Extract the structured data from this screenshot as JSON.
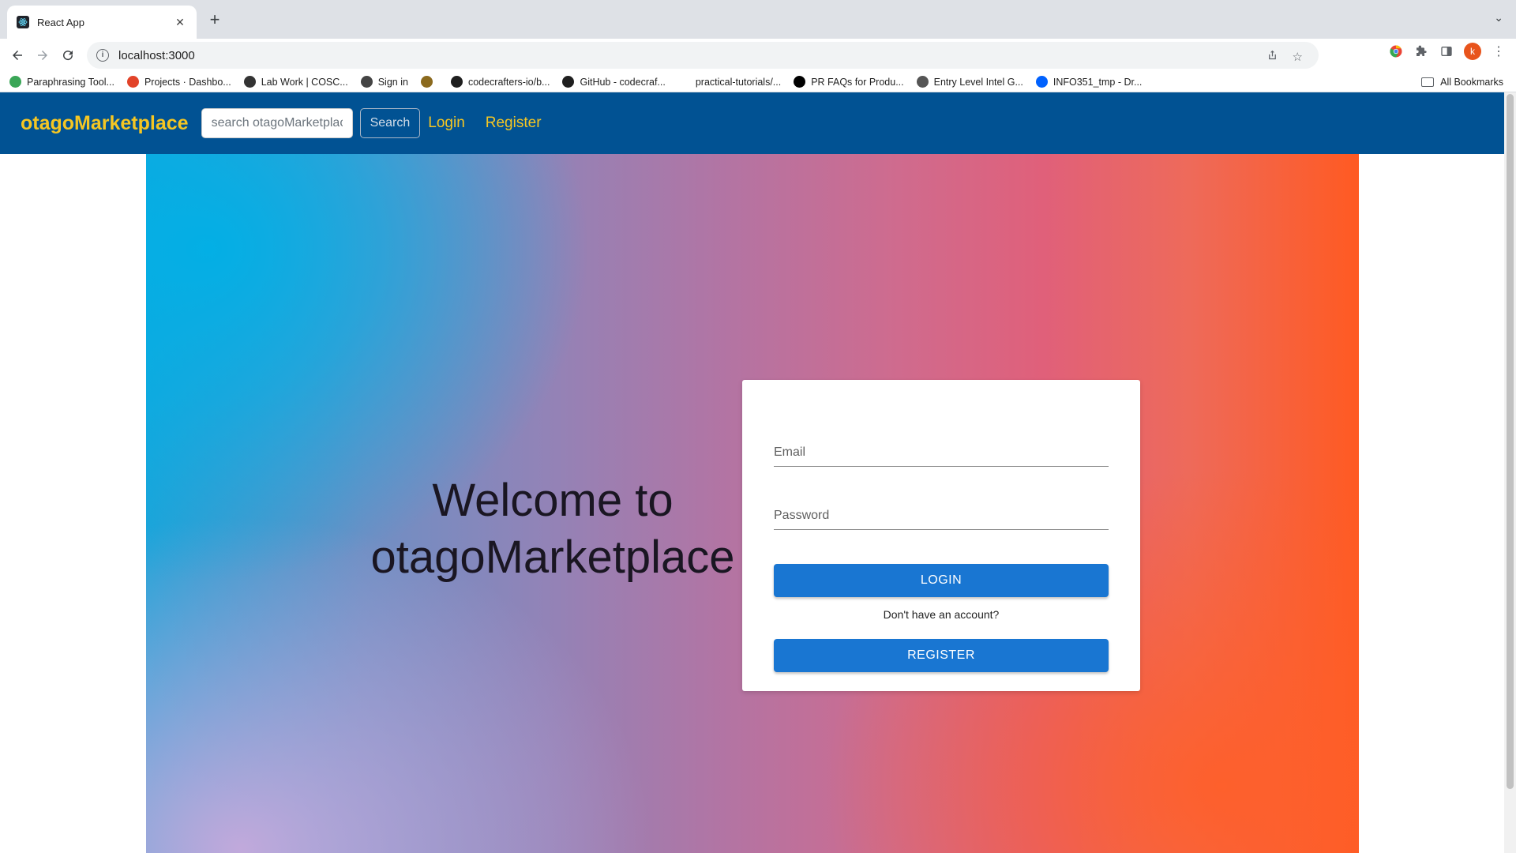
{
  "browser": {
    "tab_title": "React App",
    "new_tab_label": "+",
    "url": "localhost:3000",
    "profile_initial": "k"
  },
  "bookmarks": [
    {
      "label": "Paraphrasing Tool...",
      "icon": "paraphrasing-icon",
      "color": "#3aa657"
    },
    {
      "label": "Projects · Dashbo...",
      "icon": "gitlab-icon",
      "color": "#e24329"
    },
    {
      "label": "Lab Work | COSC...",
      "icon": "runner-icon",
      "color": "#333333"
    },
    {
      "label": "Sign in",
      "icon": "globe-icon",
      "color": "#444444"
    },
    {
      "label": "",
      "icon": "crest-icon",
      "color": "#8b6a1e"
    },
    {
      "label": "codecrafters-io/b...",
      "icon": "github-icon",
      "color": "#1f1f1f"
    },
    {
      "label": "GitHub - codecraf...",
      "icon": "github-icon",
      "color": "#1f1f1f"
    },
    {
      "label": "practical-tutorials/...",
      "icon": "blank-icon",
      "color": "#ffffff"
    },
    {
      "label": "PR FAQs for Produ...",
      "icon": "medium-icon",
      "color": "#000000"
    },
    {
      "label": "Entry Level Intel G...",
      "icon": "cube-icon",
      "color": "#555555"
    },
    {
      "label": "INFO351_tmp - Dr...",
      "icon": "dropbox-icon",
      "color": "#0061fe"
    }
  ],
  "all_bookmarks_label": "All Bookmarks",
  "app": {
    "brand": "otagoMarketplace",
    "search_placeholder": "search otagoMarketplace",
    "search_button": "Search",
    "nav": [
      "Login",
      "Register"
    ],
    "welcome_line1": "Welcome to",
    "welcome_line2": "otagoMarketplace",
    "email_label": "Email",
    "password_label": "Password",
    "login_button": "LOGIN",
    "no_account_text": "Don't have an account?",
    "register_button": "REGISTER"
  },
  "colors": {
    "appbar": "#015293",
    "brand": "#f5c623",
    "primary_button": "#1976d2"
  }
}
